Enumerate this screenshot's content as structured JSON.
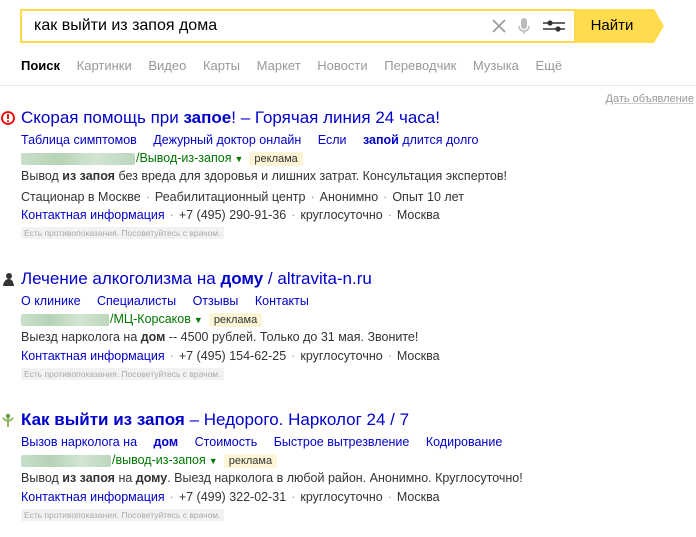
{
  "search": {
    "query": "как выйти из запоя дома",
    "button": "Найти"
  },
  "tabs": [
    {
      "label": "Поиск",
      "active": true
    },
    {
      "label": "Картинки"
    },
    {
      "label": "Видео"
    },
    {
      "label": "Карты"
    },
    {
      "label": "Маркет"
    },
    {
      "label": "Новости"
    },
    {
      "label": "Переводчик"
    },
    {
      "label": "Музыка"
    },
    {
      "label": "Ещё"
    }
  ],
  "ad_link": "Дать объявление",
  "results": [
    {
      "icon": "alert-circle-icon",
      "title_pre": "Скорая помощь при ",
      "title_bold": "запое",
      "title_post": "! – Горячая линия 24 часа!",
      "links": [
        "Таблица симптомов",
        "Дежурный доктор онлайн",
        "Если ",
        "запой",
        " длится долго"
      ],
      "url_path": "/Вывод-из-запоя",
      "badge": "реклама",
      "text_pre": "Вывод ",
      "text_bold": "из запоя",
      "text_post": " без вреда для здоровья и лишних затрат. Консультация экспертов!",
      "meta": [
        "Стационар в Москве",
        "Реабилитационный центр",
        "Анонимно",
        "Опыт 10 лет"
      ],
      "contact": "Контактная информация",
      "phone": "+7 (495) 290-91-36",
      "hours": "круглосуточно",
      "city": "Москва",
      "warning": "Есть противопоказания. Посоветуйтесь с врачом."
    },
    {
      "icon": "person-icon",
      "title_pre": "Лечение алкоголизма на ",
      "title_bold": "дому",
      "title_post": " / altravita-n.ru",
      "links": [
        "О клинике",
        "Специалисты",
        "Отзывы",
        "Контакты"
      ],
      "url_path": "/МЦ-Корсаков",
      "badge": "реклама",
      "text_pre": "Выезд нарколога на ",
      "text_bold": "дом",
      "text_post": " -- 4500 рублей. Только до 31 мая. Звоните!",
      "contact": "Контактная информация",
      "phone": "+7 (495) 154-62-25",
      "hours": "круглосуточно",
      "city": "Москва",
      "warning": "Есть противопоказания. Посоветуйтесь с врачом."
    },
    {
      "icon": "leaf-icon",
      "title_bold": "Как выйти из запоя",
      "title_post": " – Недорого. Нарколог 24 / 7",
      "links": [
        "Вызов нарколога на ",
        "дом",
        "Стоимость",
        "Быстрое вытрезвление",
        "Кодирование"
      ],
      "url_path": "/вывод-из-запоя",
      "badge": "реклама",
      "text_pre": "Вывод ",
      "text_bold": "из запоя",
      "text_mid": " на ",
      "text_bold2": "дому",
      "text_post": ". Выезд нарколога в любой район. Анонимно. Круглосуточно!",
      "contact": "Контактная информация",
      "phone": "+7 (499) 322-02-31",
      "hours": "круглосуточно",
      "city": "Москва",
      "warning": "Есть противопоказания. Посоветуйтесь с врачом."
    }
  ]
}
